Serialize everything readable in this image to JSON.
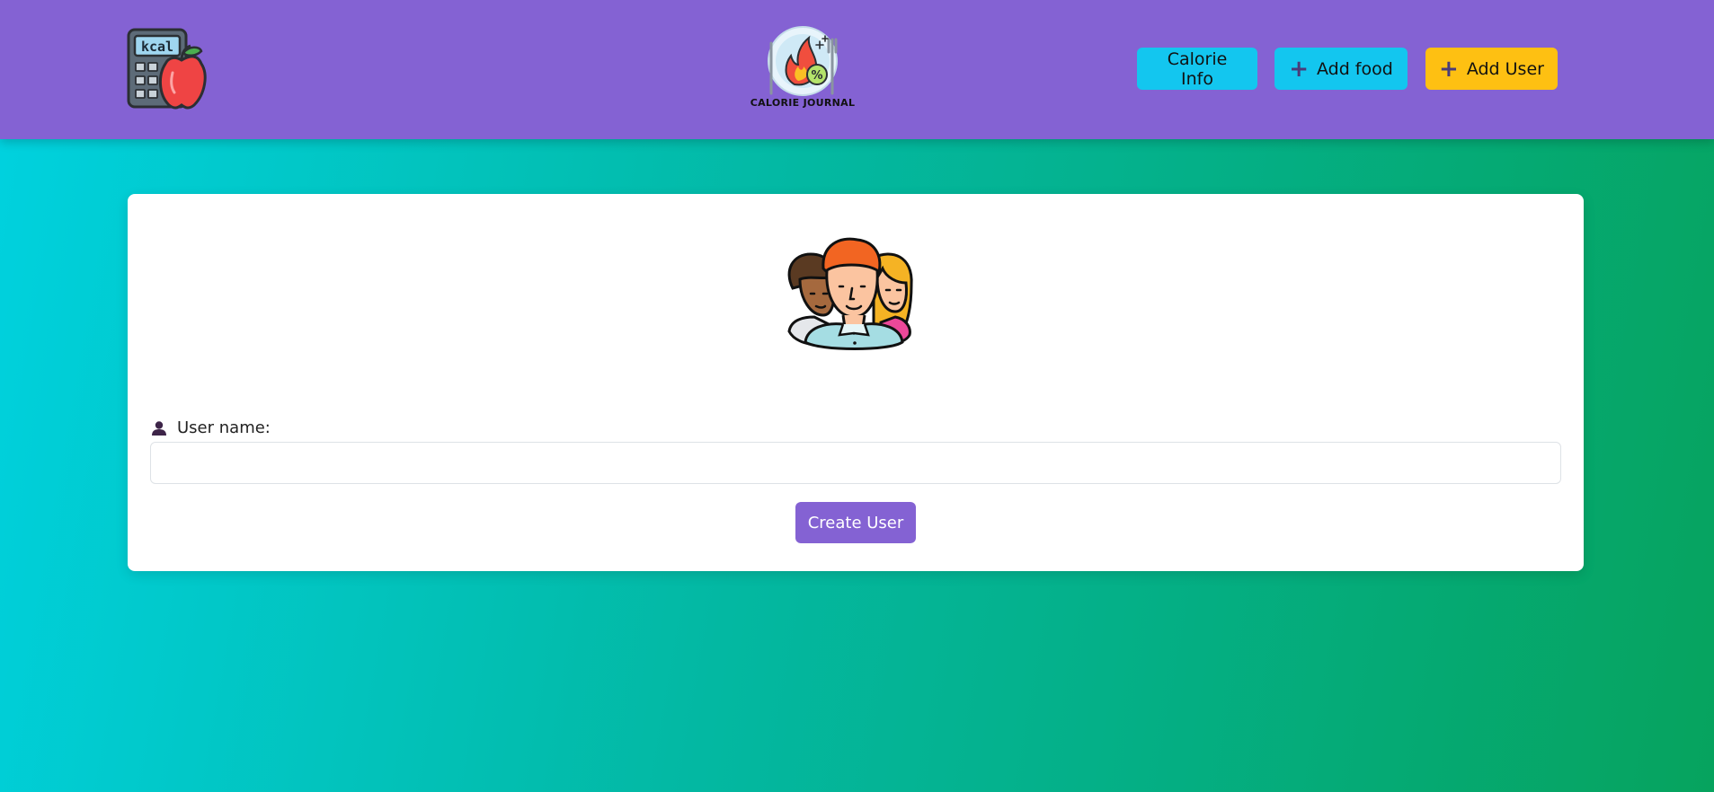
{
  "brand": {
    "left_logo_icon": "calculator-kcal-apple-icon",
    "center_logo_icon": "calorie-journal-logo",
    "center_logo_text": "CALORIE JOURNAL"
  },
  "nav": {
    "calorie_info_label": "Calorie Info",
    "add_food_label": "Add food",
    "add_user_label": "Add User",
    "plus_icon": "plus-icon"
  },
  "form": {
    "illustration": "users-group-illustration",
    "user_name_label": "User name:",
    "user_name_value": "",
    "user_name_placeholder": "",
    "submit_label": "Create User"
  },
  "colors": {
    "navbar": "#8462d3",
    "info_button": "#13c6ef",
    "add_user_button": "#fec012",
    "primary_button": "#8462d3",
    "background_start": "#00d2e0",
    "background_end": "#06a35e"
  }
}
